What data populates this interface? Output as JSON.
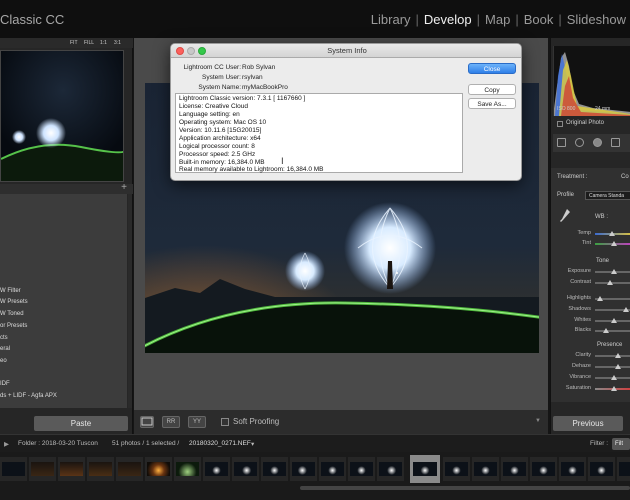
{
  "app": {
    "title": "Classic CC",
    "modules": [
      "Library",
      "Develop",
      "Map",
      "Book",
      "Slideshow"
    ],
    "active_module": "Develop"
  },
  "navigator": {
    "zoom_options": [
      "FIT",
      "FILL",
      "1:1",
      "3:1"
    ]
  },
  "presets": {
    "items": [
      "W Filter",
      "W Presets",
      "W Toned",
      "or Presets",
      "cts",
      "eral",
      "eo",
      "IDF",
      "ds + LIDF - Agfa APX"
    ]
  },
  "left_footer": {
    "paste_label": "Paste"
  },
  "toolbar": {
    "soft_proofing_label": "Soft Proofing",
    "view_btn1": "YY",
    "view_btn2": "RR"
  },
  "right_panel": {
    "hist_info_iso": "ISO 800",
    "hist_info_focal": "24 mm",
    "original_photo_label": "Original Photo",
    "treatment_label": "Treatment :",
    "treatment_value": "Co",
    "profile_label": "Profile",
    "profile_value": "Camera Standa",
    "wb_label": "WB :",
    "basic_sliders": [
      "Temp",
      "Tint"
    ],
    "tone_label": "Tone",
    "tone_sliders": [
      "Exposure",
      "Contrast",
      "Highlights",
      "Shadows",
      "Whites",
      "Blacks"
    ],
    "presence_label": "Presence",
    "presence_sliders": [
      "Clarity",
      "Dehaze",
      "Vibrance",
      "Saturation"
    ],
    "previous_label": "Previous"
  },
  "filmstrip_bar": {
    "folder_text": "Folder : 2018-03-20 Tuscon",
    "count_text": "51 photos / 1 selected /",
    "filename": "20180320_0271.NEF",
    "filter_label": "Filter :",
    "filter_btn": "Filt"
  },
  "dialog": {
    "title": "System Info",
    "fields": [
      {
        "label": "Lightroom CC User:",
        "value": "Rob Sylvan"
      },
      {
        "label": "System User:",
        "value": "rsylvan"
      },
      {
        "label": "System Name:",
        "value": "myMacBookPro"
      }
    ],
    "info_lines": [
      "Lightroom Classic version: 7.3.1 [ 1167660 ]",
      "License: Creative Cloud",
      "Language setting: en",
      "Operating system: Mac OS 10",
      "Version: 10.11.6 [15G20015]",
      "Application architecture: x64",
      "Logical processor count: 8",
      "Processor speed: 2.5 GHz",
      "Built-in memory: 16,384.0 MB",
      "Real memory available to Lightroom: 16,384.0 MB"
    ],
    "close_label": "Close",
    "copy_label": "Copy",
    "save_as_label": "Save As..."
  }
}
